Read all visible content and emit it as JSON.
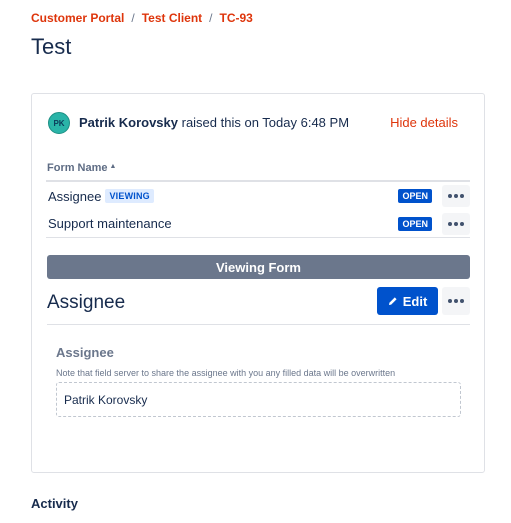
{
  "breadcrumb": {
    "items": [
      "Customer Portal",
      "Test Client",
      "TC-93"
    ],
    "separator": "/"
  },
  "page_title": "Test",
  "request": {
    "avatar_initials": "PK",
    "reporter_name": "Patrik Korovsky",
    "raised_text": " raised this on Today 6:48 PM",
    "hide_details_label": "Hide details"
  },
  "forms_table": {
    "header": "Form Name",
    "sort_indicator": "▲",
    "rows": [
      {
        "name": "Assignee",
        "badge": "VIEWING",
        "status": "OPEN"
      },
      {
        "name": "Support maintenance",
        "badge": "",
        "status": "OPEN"
      }
    ]
  },
  "viewer": {
    "banner": "Viewing Form",
    "title": "Assignee",
    "edit_label": "Edit",
    "field_label": "Assignee",
    "field_help": "Note that field server to share the assignee with you any filled data will be overwritten",
    "field_value": "Patrik Korovsky"
  },
  "activity_heading": "Activity",
  "colors": {
    "brand_link": "#de350b",
    "primary": "#0052cc",
    "banner": "#6b778c",
    "lozenge_bg": "#deebff",
    "avatar": "#2ab4a8"
  },
  "icons": {
    "more": "more-icon",
    "edit": "pencil-icon",
    "sort": "sort-ascending-icon"
  }
}
